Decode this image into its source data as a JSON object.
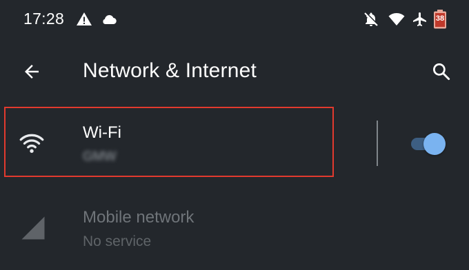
{
  "status_bar": {
    "time": "17:28",
    "icons": [
      "warning-icon",
      "cloud-icon",
      "notifications-off-icon",
      "wifi-signal-icon",
      "airplane-mode-icon",
      "battery-icon"
    ],
    "battery_level": "38"
  },
  "app_bar": {
    "back_icon": "arrow-back-icon",
    "title": "Network & Internet",
    "search_icon": "search-icon"
  },
  "settings": {
    "wifi": {
      "icon": "wifi-icon",
      "label": "Wi-Fi",
      "network_name": "GMW",
      "enabled": true
    },
    "mobile_network": {
      "icon": "cellular-signal-icon",
      "label": "Mobile network",
      "status": "No service"
    }
  },
  "colors": {
    "background": "#23272c",
    "highlight_border": "#e23a2e",
    "toggle_thumb": "#7ab3f0",
    "toggle_track": "#3d5e82",
    "disabled_text": "#6f7479"
  }
}
